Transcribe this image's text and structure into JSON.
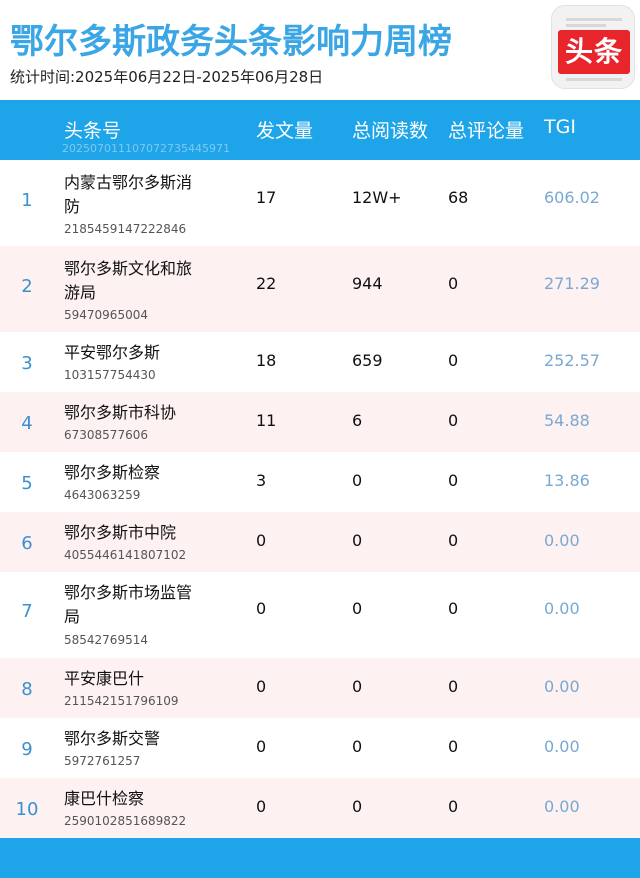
{
  "header": {
    "title": "鄂尔多斯政务头条影响力周榜",
    "subtitle": "统计时间:2025年06月22日-2025年06月28日",
    "logo_text": "头条"
  },
  "colors": {
    "accent": "#1ea4e8",
    "title": "#3ba6e6",
    "logo_red": "#e8252b",
    "alt_row": "#fdf1f1",
    "tgi": "#7aa8d2"
  },
  "table": {
    "headers": {
      "account": "头条号",
      "posts": "发文量",
      "reads": "总阅读数",
      "comments": "总评论量",
      "tgi": "TGI"
    },
    "header_id": "20250701110707273544597​1",
    "rows": [
      {
        "rank": "1",
        "name": "内蒙古鄂尔多斯消防",
        "id": "2185459147222846",
        "posts": "17",
        "reads": "12W+",
        "comments": "68",
        "tgi": "606.02"
      },
      {
        "rank": "2",
        "name": "鄂尔多斯文化和旅游局",
        "id": "59470965004",
        "posts": "22",
        "reads": "944",
        "comments": "0",
        "tgi": "271.29"
      },
      {
        "rank": "3",
        "name": "平安鄂尔多斯",
        "id": "103157754430",
        "posts": "18",
        "reads": "659",
        "comments": "0",
        "tgi": "252.57"
      },
      {
        "rank": "4",
        "name": "鄂尔多斯市科协",
        "id": "67308577606",
        "posts": "11",
        "reads": "6",
        "comments": "0",
        "tgi": "54.88"
      },
      {
        "rank": "5",
        "name": "鄂尔多斯检察",
        "id": "4643063259",
        "posts": "3",
        "reads": "0",
        "comments": "0",
        "tgi": "13.86"
      },
      {
        "rank": "6",
        "name": "鄂尔多斯市中院",
        "id": "4055446141807102",
        "posts": "0",
        "reads": "0",
        "comments": "0",
        "tgi": "0.00"
      },
      {
        "rank": "7",
        "name": "鄂尔多斯市场监管局",
        "id": "58542769514",
        "posts": "0",
        "reads": "0",
        "comments": "0",
        "tgi": "0.00"
      },
      {
        "rank": "8",
        "name": "平安康巴什",
        "id": "211542151796109",
        "posts": "0",
        "reads": "0",
        "comments": "0",
        "tgi": "0.00"
      },
      {
        "rank": "9",
        "name": "鄂尔多斯交警",
        "id": "5972761257",
        "posts": "0",
        "reads": "0",
        "comments": "0",
        "tgi": "0.00"
      },
      {
        "rank": "10",
        "name": "康巴什检察",
        "id": "2590102851689822",
        "posts": "0",
        "reads": "0",
        "comments": "0",
        "tgi": "0.00"
      }
    ]
  }
}
